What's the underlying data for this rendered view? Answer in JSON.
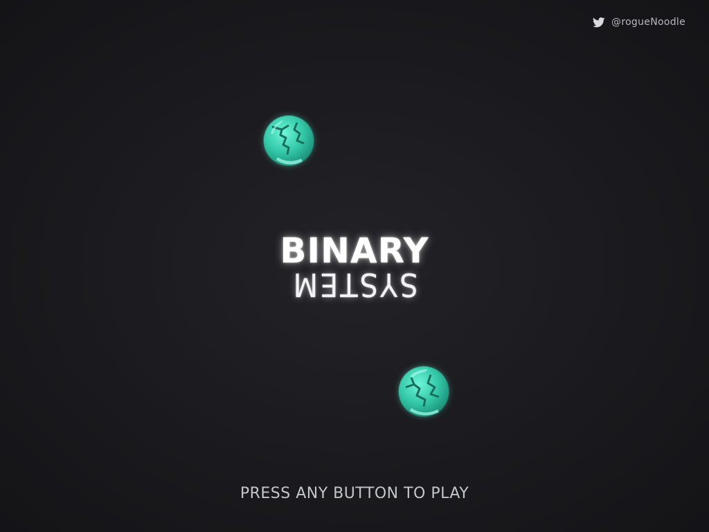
{
  "social": {
    "icon": "twitter-bird-icon",
    "handle": "@rogueNoodle"
  },
  "title": {
    "line1": "BINARY",
    "line2": "SYSTEM"
  },
  "prompt": "PRESS ANY BUTTON TO PLAY",
  "planets": [
    {
      "name": "planet-top",
      "icon": "planet-icon"
    },
    {
      "name": "planet-bottom",
      "icon": "planet-icon"
    }
  ],
  "colors": {
    "background": "#1c1c20",
    "planet": "#3fd6b6",
    "planet_glow": "#5ff0d4",
    "text": "#ffffff",
    "prompt_text": "#c4c6cb"
  }
}
